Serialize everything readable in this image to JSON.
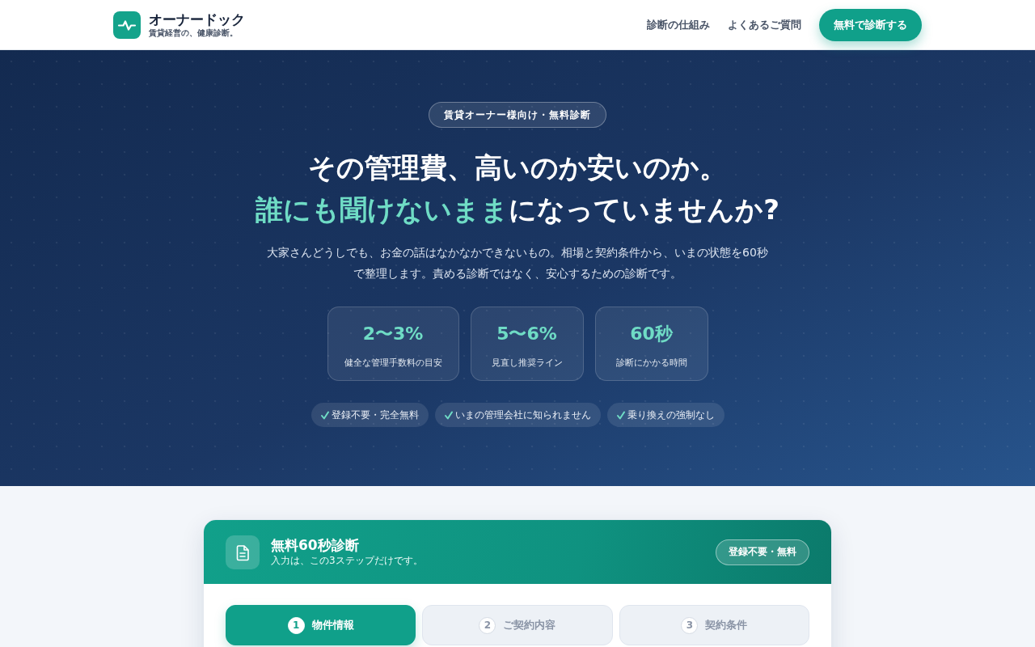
{
  "header": {
    "brand": "オーナードック",
    "tagline": "賃貸経営の、健康診断。",
    "nav": [
      "診断の仕組み",
      "よくあるご質問"
    ],
    "cta": "無料で診断する"
  },
  "hero": {
    "badge": "賃貸オーナー様向け・無料診断",
    "title": [
      "その管理費、高いのか安いのか。",
      "**誰にも聞けないまま**になっていませんか?"
    ],
    "description": "大家さんどうしでも、お金の話はなかなかできないもの。相場と契約条件から、いまの状態を60秒で整理します。責める診断ではなく、安心するための診断です。",
    "stats": [
      {
        "value": "2〜3%",
        "label": "健全な管理手数料の目安"
      },
      {
        "value": "5〜6%",
        "label": "見直し推奨ライン"
      },
      {
        "value": "60秒",
        "label": "診断にかかる時間"
      }
    ],
    "features": [
      "登録不要・完全無料",
      "いまの管理会社に知られません",
      "乗り換えの強制なし"
    ]
  },
  "diagnosis": {
    "title": "無料60秒診断",
    "subtitle": "入力は、この3ステップだけです。",
    "badge": "登録不要・無料",
    "steps": [
      {
        "number": "1",
        "label": "物件情報",
        "selected": true
      },
      {
        "number": "2",
        "label": "ご契約内容",
        "selected": false
      },
      {
        "number": "3",
        "label": "契約条件",
        "selected": false
      }
    ]
  }
}
